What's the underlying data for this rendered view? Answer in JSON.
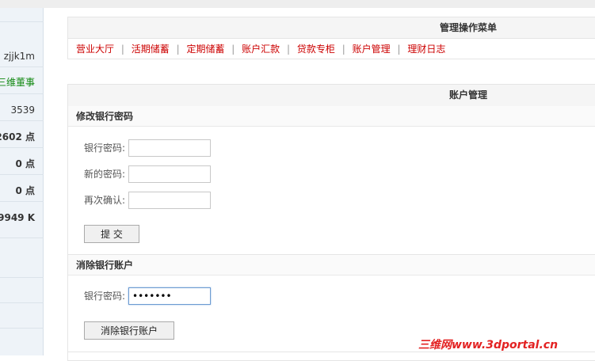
{
  "sidebar": {
    "username": "zjjk1m",
    "group": "三维董事",
    "stat1": "3539",
    "stat2": "2602 点",
    "stat3": "0 点",
    "stat4": "0 点",
    "stat5": "9949 K"
  },
  "menu": {
    "title": "管理操作菜单",
    "links": [
      "营业大厅",
      "活期储蓄",
      "定期储蓄",
      "账户汇款",
      "贷款专柜",
      "账户管理",
      "理财日志"
    ]
  },
  "account": {
    "title": "账户管理",
    "change_password": {
      "title": "修改银行密码",
      "bank_password_label": "银行密码:",
      "new_password_label": "新的密码:",
      "confirm_label": "再次确认:",
      "submit_label": "提 交"
    },
    "close_account": {
      "title": "消除银行账户",
      "bank_password_label": "银行密码:",
      "password_value": "•••••••",
      "button_label": "消除银行账户"
    }
  },
  "watermark": "三维网www.3dportal.cn",
  "colors": {
    "menu_link": "#cc0000",
    "sidebar_group": "#118811",
    "watermark": "#e32222"
  }
}
